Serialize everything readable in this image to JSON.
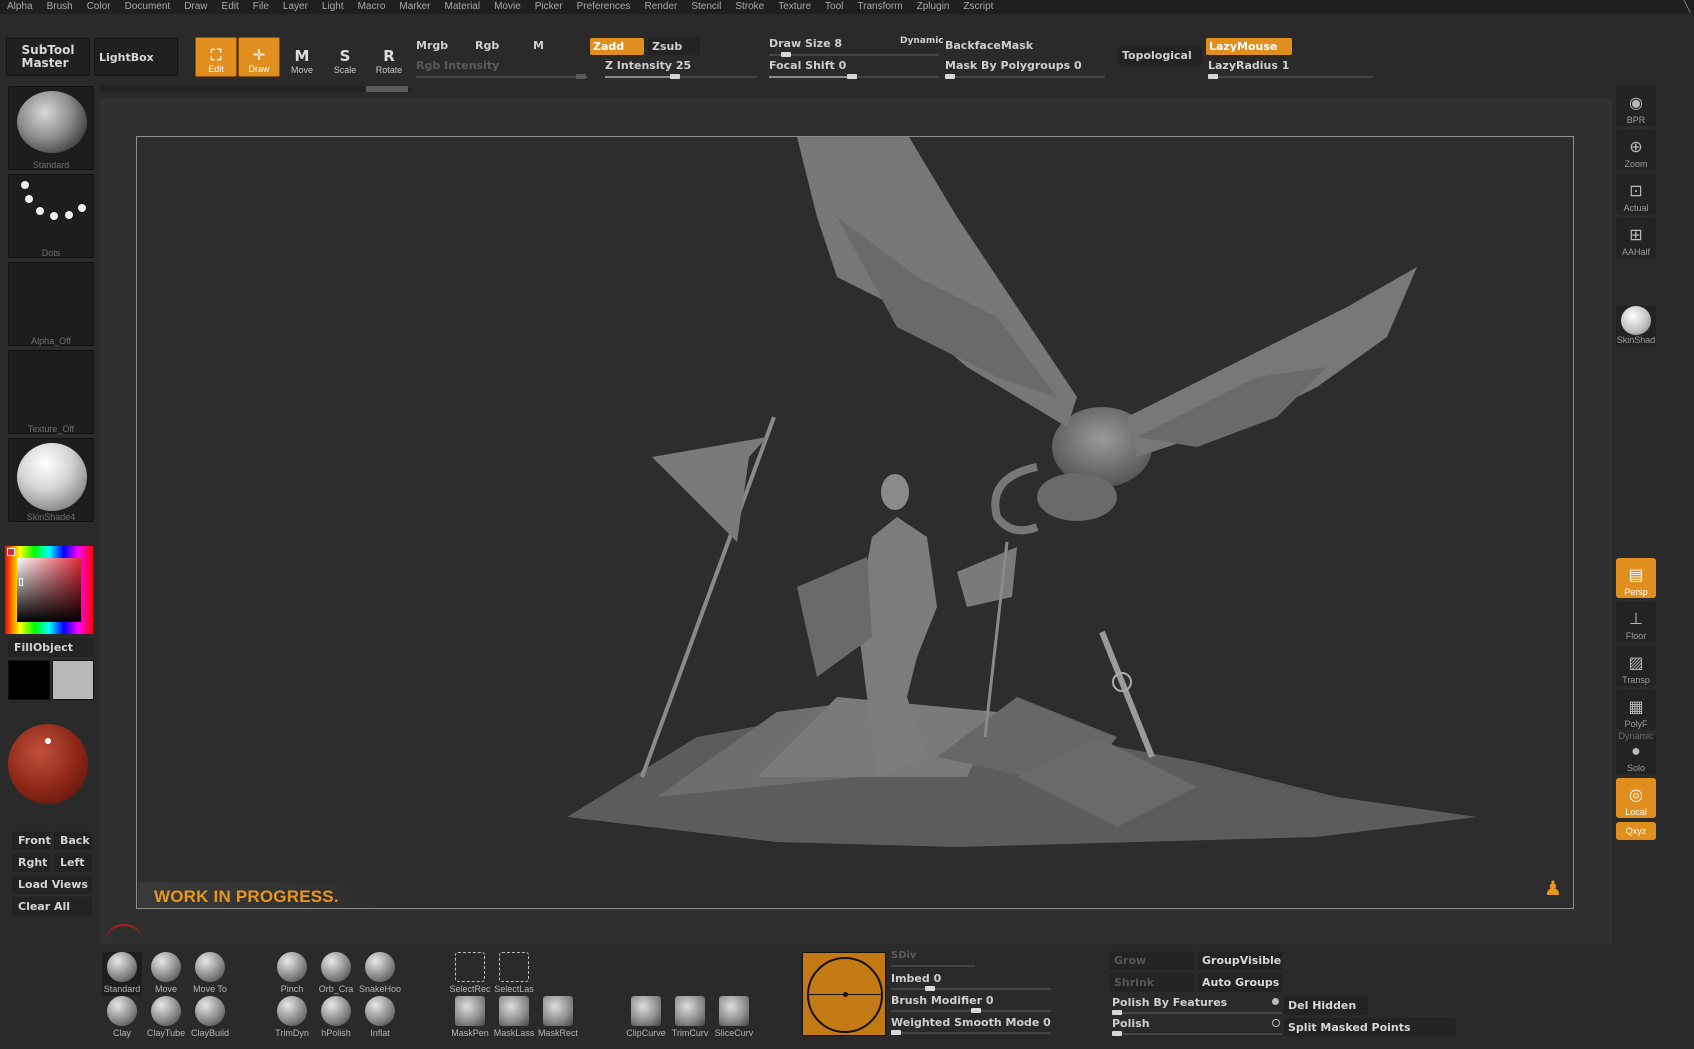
{
  "menu": [
    "Alpha",
    "Brush",
    "Color",
    "Document",
    "Draw",
    "Edit",
    "File",
    "Layer",
    "Light",
    "Macro",
    "Marker",
    "Material",
    "Movie",
    "Picker",
    "Preferences",
    "Render",
    "Stencil",
    "Stroke",
    "Texture",
    "Tool",
    "Transform",
    "Zplugin",
    "Zscript"
  ],
  "topshelf": {
    "subtool_master": "SubTool\nMaster",
    "lightbox": "LightBox",
    "edit": "Edit",
    "draw": "Draw",
    "move": "Move",
    "scale": "Scale",
    "rotate": "Rotate",
    "mrgb": "Mrgb",
    "rgb": "Rgb",
    "m": "M",
    "zadd": "Zadd",
    "zsub": "Zsub",
    "rgb_intensity": "Rgb Intensity",
    "z_intensity": "Z Intensity 25",
    "draw_size": "Draw Size 8",
    "dynamic": "Dynamic",
    "focal_shift": "Focal Shift 0",
    "backface_mask": "BackfaceMask",
    "mask_by_polygroups": "Mask By Polygroups 0",
    "topological": "Topological",
    "lazymouse": "LazyMouse",
    "lazyradius": "LazyRadius 1"
  },
  "leftshelf": {
    "brush_caption": "Standard",
    "stroke_caption": "Dots",
    "alpha_caption": "Alpha_Off",
    "texture_caption": "Texture_Off",
    "material_caption": "SkinShade4",
    "fill_object": "FillObject",
    "views": {
      "front": "Front",
      "back": "Back",
      "right": "Rght",
      "left": "Left",
      "load_views": "Load Views",
      "clear_all": "Clear All"
    }
  },
  "rightshelf": {
    "bpr": "BPR",
    "zoom": "Zoom",
    "actual": "Actual",
    "aahalf": "AAHalf",
    "skinshade": "SkinShad",
    "persp": "Persp",
    "floor": "Floor",
    "transp": "Transp",
    "polyf": "PolyF",
    "dynamic": "Dynamic",
    "solo": "Solo",
    "local": "Local",
    "xyz": "Qxyz"
  },
  "canvas": {
    "wip_text": "WORK IN PROGRESS."
  },
  "bottomshelf": {
    "brushes_row1": [
      "Standard",
      "Move",
      "Move To",
      "Pinch",
      "Orb_Cra",
      "SnakeHoo"
    ],
    "brushes_row2": [
      "Clay",
      "ClayTube",
      "ClayBuild",
      "TrimDyn",
      "hPolish",
      "Inflat"
    ],
    "select": [
      "SelectRec",
      "SelectLas"
    ],
    "masks": [
      "MaskPen",
      "MaskLass",
      "MaskRect"
    ],
    "clips": [
      "ClipCurve",
      "TrimCurv",
      "SliceCurv"
    ],
    "sdiv": "SDiv",
    "imbed": "Imbed 0",
    "brush_modifier": "Brush Modifier 0",
    "weighted_smooth": "Weighted Smooth Mode 0",
    "grow": "Grow",
    "shrink": "Shrink",
    "group_visible": "GroupVisible",
    "auto_groups": "Auto Groups",
    "polish_by_features": "Polish By Features",
    "polish": "Polish",
    "del_hidden": "Del Hidden",
    "split_masked": "Split Masked Points"
  },
  "colors": {
    "accent": "#e08f1e",
    "wip": "#e8961c",
    "bg": "#2b2b2b"
  }
}
